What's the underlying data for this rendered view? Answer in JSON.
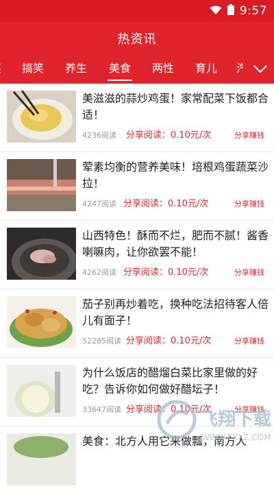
{
  "status_bar": {
    "time": "9:57",
    "wifi_icon": "wifi-icon",
    "battery_icon": "battery-icon"
  },
  "header": {
    "title": "热资讯"
  },
  "tabs": [
    {
      "label": "搞笑"
    },
    {
      "label": "养生"
    },
    {
      "label": "美食",
      "active": true
    },
    {
      "label": "两性"
    },
    {
      "label": "育儿"
    }
  ],
  "tabs_more_icon": "chevron-down-icon",
  "articles": [
    {
      "title": "美滋滋的蒜炒鸡蛋！家常配菜下饭都合适！",
      "reads": "4236阅读",
      "share": "分享阅读：0.10元/次",
      "earn": "分享赚钱"
    },
    {
      "title": "荤素均衡的营养美味！培根鸡蛋蔬菜沙拉！",
      "reads": "4247阅读",
      "share": "分享阅读：0.10元/次",
      "earn": "分享赚钱"
    },
    {
      "title": "山西特色！酥而不烂，肥而不腻！酱香喇嘛肉，让你欲罢不能！",
      "reads": "4262阅读",
      "share": "分享阅读：0.10元/次",
      "earn": "分享赚钱"
    },
    {
      "title": "茄子别再炒着吃，换种吃法招待客人倍儿有面子！",
      "reads": "52285阅读",
      "share": "分享阅读：0.10元/次",
      "earn": "分享赚钱"
    },
    {
      "title": "为什么饭店的醋熘白菜比家里做的好吃？告诉你如何做好醋坛子！",
      "reads": "33647阅读",
      "share": "分享阅读：0.10元/次",
      "earn": "分享赚钱"
    },
    {
      "title": "美食：北方人用它来做瓢，南方人",
      "reads": "",
      "share": "",
      "earn": ""
    }
  ],
  "watermark": {
    "text": "飞翔下载",
    "url": "WWW.FXXZ.COM"
  },
  "colors": {
    "brand_red": "#e0242d",
    "status_red": "#d81c25"
  }
}
